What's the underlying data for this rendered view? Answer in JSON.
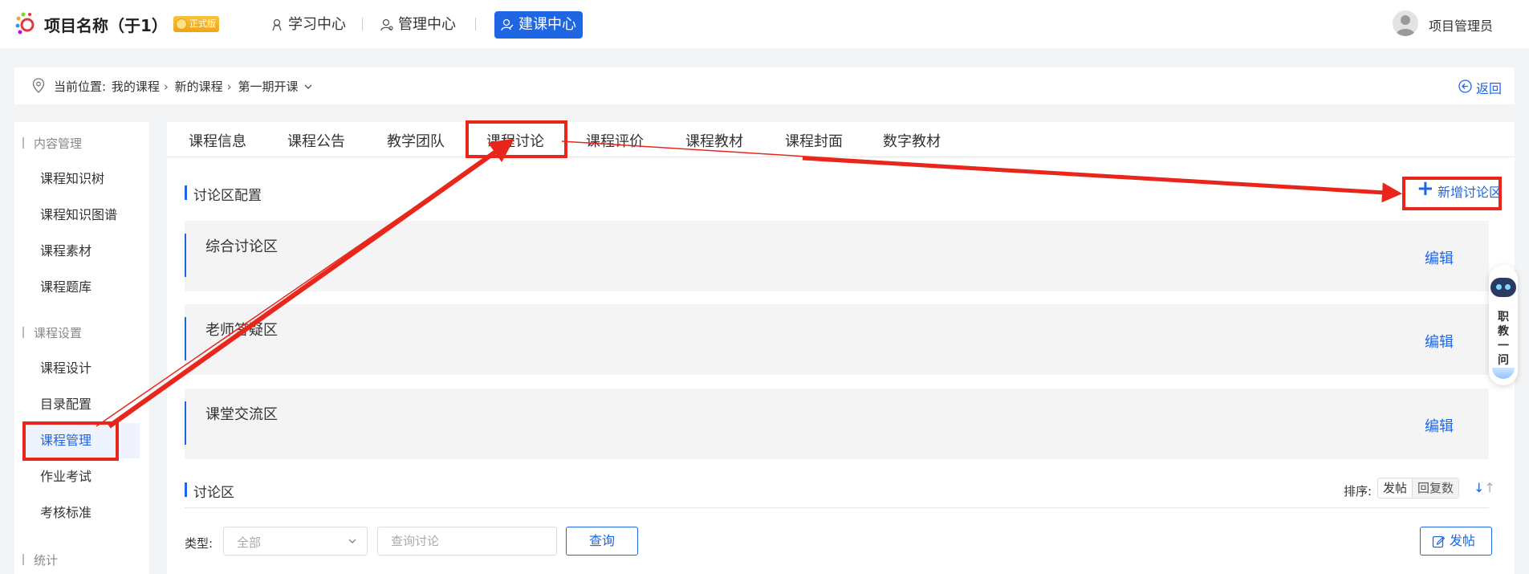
{
  "header": {
    "project_name": "项目名称（于1）",
    "edition_badge": "正式版",
    "nav": [
      "学习中心",
      "管理中心",
      "建课中心"
    ],
    "active_nav": "建课中心",
    "username": "项目管理员"
  },
  "breadcrumb": {
    "prefix": "当前位置:",
    "items": [
      "我的课程",
      "新的课程",
      "第一期开课"
    ],
    "back_label": "返回"
  },
  "sidebar": {
    "groups": [
      {
        "title": "内容管理",
        "items": [
          "课程知识树",
          "课程知识图谱",
          "课程素材",
          "课程题库"
        ]
      },
      {
        "title": "课程设置",
        "items": [
          "课程设计",
          "目录配置",
          "课程管理",
          "作业考试",
          "考核标准"
        ]
      },
      {
        "title": "统计",
        "items": []
      }
    ],
    "active_item": "课程管理"
  },
  "tabs": [
    "课程信息",
    "课程公告",
    "教学团队",
    "课程讨论",
    "课程评价",
    "课程教材",
    "课程封面",
    "数字教材"
  ],
  "active_tab": "课程讨论",
  "zone_config": {
    "title": "讨论区配置",
    "add_label": "新增讨论区",
    "zones": [
      {
        "name": "综合讨论区",
        "action": "编辑"
      },
      {
        "name": "老师答疑区",
        "action": "编辑"
      },
      {
        "name": "课堂交流区",
        "action": "编辑"
      }
    ]
  },
  "discussion": {
    "title": "讨论区",
    "sort_label": "排序:",
    "sort_options": [
      "发帖",
      "回复数"
    ],
    "sort_selected": "回复数",
    "type_label": "类型:",
    "type_value": "全部",
    "search_placeholder": "查询讨论",
    "query_label": "查询",
    "post_label": "发帖"
  },
  "assistant": {
    "label": "职教一问"
  },
  "colors": {
    "accent": "#1f66e5",
    "annotation": "#e8261c",
    "badge": "#f0ab1b"
  }
}
